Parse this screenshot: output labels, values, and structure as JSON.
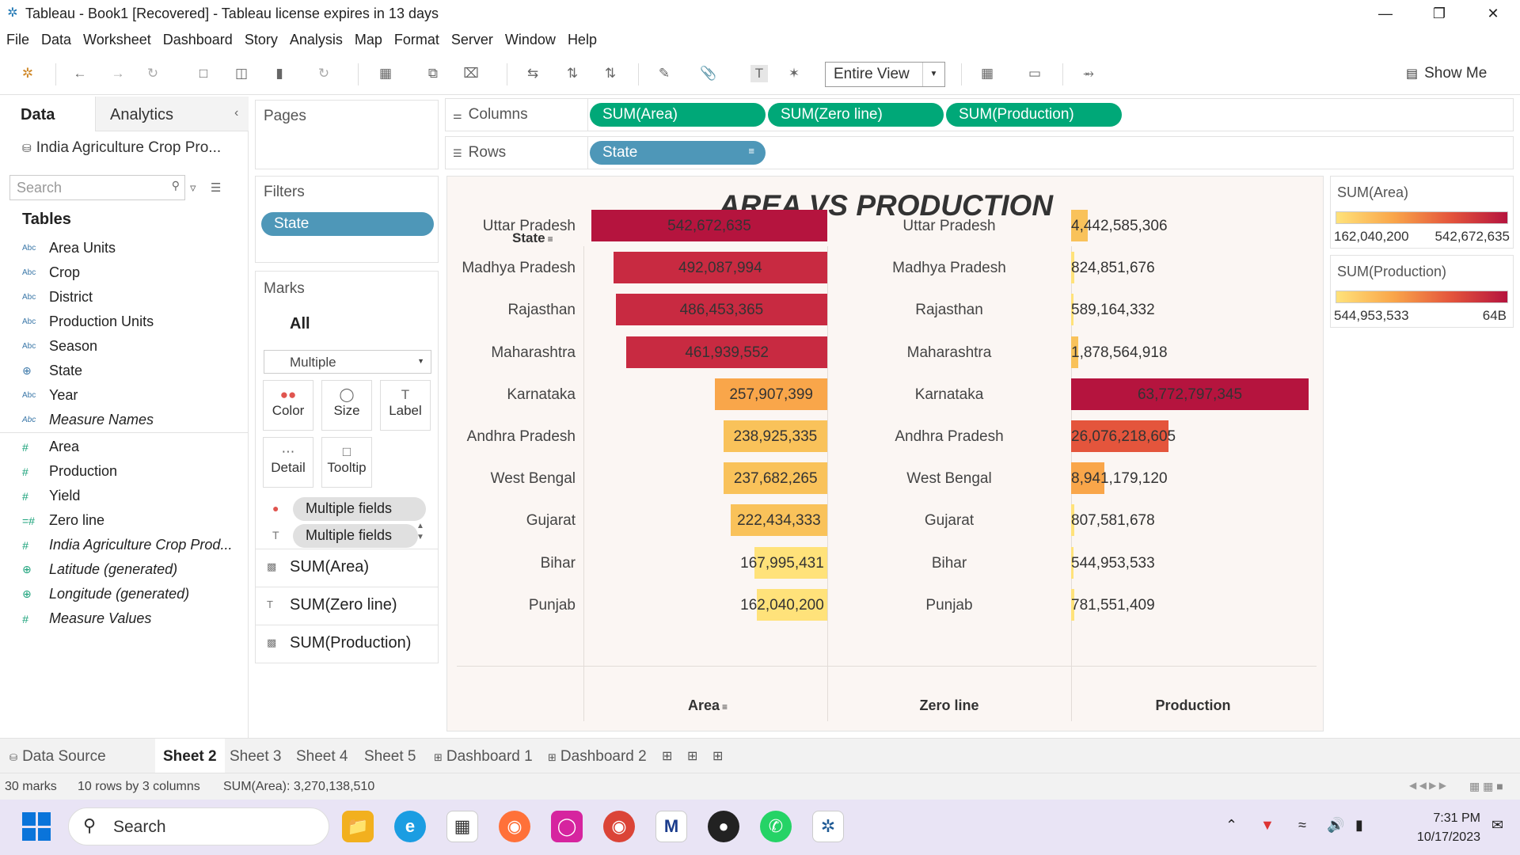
{
  "window": {
    "title": "Tableau - Book1 [Recovered] - Tableau license expires in 13 days"
  },
  "menu": [
    "File",
    "Data",
    "Worksheet",
    "Dashboard",
    "Story",
    "Analysis",
    "Map",
    "Format",
    "Server",
    "Window",
    "Help"
  ],
  "toolbar": {
    "fit_value": "Entire View",
    "show_me": "Show Me"
  },
  "data_pane": {
    "tab_data": "Data",
    "tab_analytics": "Analytics",
    "datasource": "India Agriculture Crop Pro...",
    "search_placeholder": "Search",
    "tables_heading": "Tables",
    "dimensions": [
      {
        "type": "Abc",
        "name": "Area Units"
      },
      {
        "type": "Abc",
        "name": "Crop"
      },
      {
        "type": "Abc",
        "name": "District"
      },
      {
        "type": "Abc",
        "name": "Production Units"
      },
      {
        "type": "Abc",
        "name": "Season"
      },
      {
        "type": "globe",
        "name": "State"
      },
      {
        "type": "Abc",
        "name": "Year"
      },
      {
        "type": "Abc",
        "name": "Measure Names",
        "italic": true
      }
    ],
    "measures": [
      {
        "type": "#",
        "name": "Area"
      },
      {
        "type": "#",
        "name": "Production"
      },
      {
        "type": "#",
        "name": "Yield"
      },
      {
        "type": "#",
        "name": "Zero line"
      },
      {
        "type": "#",
        "name": "India Agriculture Crop Prod...",
        "italic": true
      },
      {
        "type": "globe",
        "name": "Latitude (generated)",
        "italic": true
      },
      {
        "type": "globe",
        "name": "Longitude (generated)",
        "italic": true
      },
      {
        "type": "#",
        "name": "Measure Values",
        "italic": true
      }
    ]
  },
  "pages": {
    "title": "Pages"
  },
  "filters": {
    "title": "Filters",
    "pill": "State"
  },
  "marks": {
    "title": "Marks",
    "all": "All",
    "mark_type": "Multiple",
    "buttons": [
      "Color",
      "Size",
      "Label",
      "Detail",
      "Tooltip"
    ],
    "fields": [
      "Multiple fields",
      "Multiple fields"
    ],
    "measures": [
      "SUM(Area)",
      "SUM(Zero line)",
      "SUM(Production)"
    ]
  },
  "shelves": {
    "columns_label": "Columns",
    "columns": [
      "SUM(Area)",
      "SUM(Zero line)",
      "SUM(Production)"
    ],
    "rows_label": "Rows",
    "rows": [
      "State"
    ]
  },
  "viz": {
    "title": "AREA VS PRODUCTION",
    "row_header": "State",
    "axis_area": "Area",
    "axis_zero": "Zero line",
    "axis_production": "Production"
  },
  "chart_data": {
    "type": "bar",
    "categories": [
      "Uttar Pradesh",
      "Madhya Pradesh",
      "Rajasthan",
      "Maharashtra",
      "Karnataka",
      "Andhra Pradesh",
      "West Bengal",
      "Gujarat",
      "Bihar",
      "Punjab"
    ],
    "series": [
      {
        "name": "SUM(Area)",
        "values": [
          542672635,
          492087994,
          486453365,
          461939552,
          257907399,
          238925335,
          237682265,
          222434333,
          167995431,
          162040200
        ],
        "labels": [
          "542,672,635",
          "492,087,994",
          "486,453,365",
          "461,939,552",
          "257,907,399",
          "238,925,335",
          "237,682,265",
          "222,434,333",
          "167,995,431",
          "162,040,200"
        ]
      },
      {
        "name": "SUM(Production)",
        "values": [
          4442585306,
          824851676,
          589164332,
          1878564918,
          63772797345,
          26076218605,
          8941179120,
          807581678,
          544953533,
          781551409
        ],
        "labels": [
          "4,442,585,306",
          "824,851,676",
          "589,164,332",
          "1,878,564,918",
          "63,772,797,345",
          "26,076,218,605",
          "8,941,179,120",
          "807,581,678",
          "544,953,533",
          "781,551,409"
        ]
      }
    ],
    "area_max": 542672635,
    "production_max": 63772797345
  },
  "legends": [
    {
      "title": "SUM(Area)",
      "min": "162,040,200",
      "max": "542,672,635"
    },
    {
      "title": "SUM(Production)",
      "min": "544,953,533",
      "max": "64B"
    }
  ],
  "sheet_tabs": {
    "data_source": "Data Source",
    "tabs": [
      "Sheet 2",
      "Sheet 3",
      "Sheet 4",
      "Sheet 5",
      "Dashboard 1",
      "Dashboard 2"
    ],
    "active": "Sheet 2"
  },
  "status": {
    "marks": "30 marks",
    "rows": "10 rows by 3 columns",
    "sum": "SUM(Area): 3,270,138,510"
  },
  "taskbar": {
    "search": "Search",
    "time": "7:31 PM",
    "date": "10/17/2023"
  }
}
